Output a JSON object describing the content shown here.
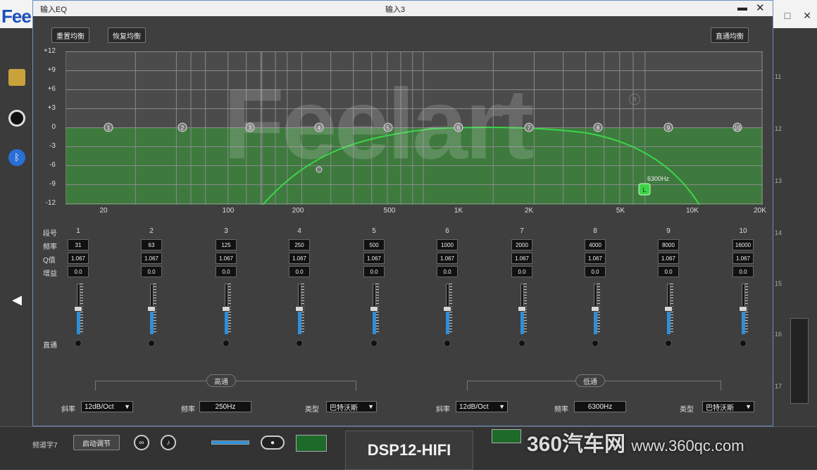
{
  "background": {
    "logo": "Fee",
    "dsp_label": "DSP12-HIFI",
    "bottom_label": "频道字7",
    "bottom_button": "启动调节",
    "right_numbers": [
      "11",
      "12",
      "13",
      "14",
      "15",
      "16",
      "17"
    ],
    "watermark_main": "360汽车网",
    "watermark_url": "www.360qc.com"
  },
  "dialog": {
    "title": "输入EQ",
    "subtitle": "输入3",
    "minimize": "▬",
    "close": "✕",
    "buttons": {
      "reset": "重置均衡",
      "restore": "恢复均衡",
      "bypass": "直通均衡"
    },
    "graph": {
      "y_labels": [
        "+12",
        "+9",
        "+6",
        "+3",
        "0",
        "-3",
        "-6",
        "-9",
        "-12"
      ],
      "x_labels": [
        "20",
        "100",
        "200",
        "500",
        "1K",
        "2K",
        "5K",
        "10K",
        "20K"
      ],
      "node_labels": [
        "1",
        "2",
        "3",
        "4",
        "5",
        "6",
        "7",
        "8",
        "9",
        "10"
      ],
      "lp_label": "L",
      "lp_freq": "6300Hz",
      "watermark": "Feelart",
      "colors": {
        "fill": "#3e7a3e",
        "curve": "#3ed34a",
        "grid": "#8a8a8a"
      }
    },
    "row_labels": {
      "band": "段号",
      "freq": "频率",
      "q": "Q值",
      "gain": "增益",
      "bypass": "直通"
    },
    "bands": [
      {
        "num": "1",
        "freq": "31",
        "q": "1.067",
        "gain": "0.0",
        "level": 0.5
      },
      {
        "num": "2",
        "freq": "63",
        "q": "1.067",
        "gain": "0.0",
        "level": 0.5
      },
      {
        "num": "3",
        "freq": "125",
        "q": "1.067",
        "gain": "0.0",
        "level": 0.5
      },
      {
        "num": "4",
        "freq": "250",
        "q": "1.067",
        "gain": "0.0",
        "level": 0.5
      },
      {
        "num": "5",
        "freq": "500",
        "q": "1.067",
        "gain": "0.0",
        "level": 0.5
      },
      {
        "num": "6",
        "freq": "1000",
        "q": "1.067",
        "gain": "0.0",
        "level": 0.5
      },
      {
        "num": "7",
        "freq": "2000",
        "q": "1.067",
        "gain": "0.0",
        "level": 0.5
      },
      {
        "num": "8",
        "freq": "4000",
        "q": "1.067",
        "gain": "0.0",
        "level": 0.5
      },
      {
        "num": "9",
        "freq": "8000",
        "q": "1.067",
        "gain": "0.0",
        "level": 0.5
      },
      {
        "num": "10",
        "freq": "16000",
        "q": "1.067",
        "gain": "0.0",
        "level": 0.5
      }
    ],
    "highpass": {
      "title": "高通",
      "slope_label": "斜率",
      "slope": "12dB/Oct",
      "freq_label": "频率",
      "freq": "250Hz",
      "type_label": "类型",
      "type": "巴特沃斯"
    },
    "lowpass": {
      "title": "低通",
      "slope_label": "斜率",
      "slope": "12dB/Oct",
      "freq_label": "频率",
      "freq": "6300Hz",
      "type_label": "类型",
      "type": "巴特沃斯"
    }
  }
}
